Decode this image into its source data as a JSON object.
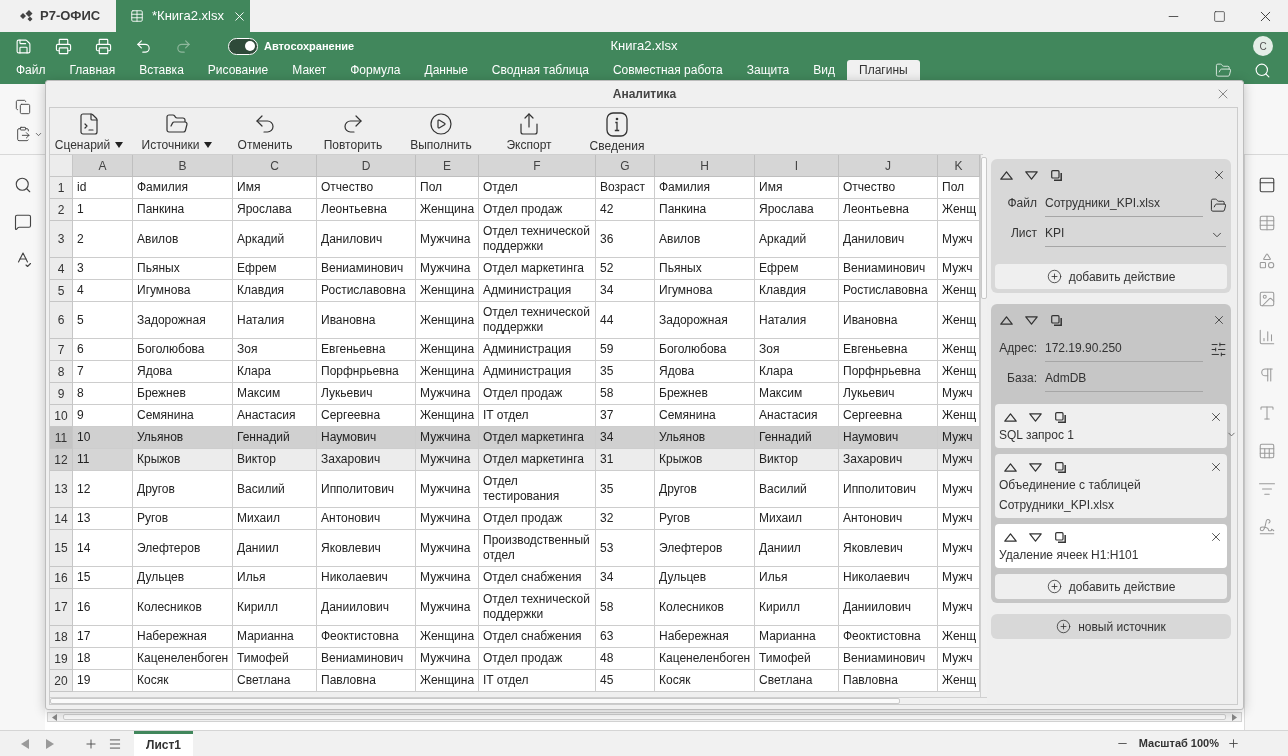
{
  "titlebar": {
    "logo": "Р7-ОФИС",
    "tabs": [
      {
        "label": "*Книга2.xlsx",
        "selected": true
      }
    ]
  },
  "header": {
    "tools": [
      {
        "kind": "save",
        "disabled": false
      },
      {
        "kind": "print",
        "disabled": false
      },
      {
        "kind": "quick_print",
        "disabled": false
      },
      {
        "kind": "undo",
        "disabled": false
      },
      {
        "kind": "redo",
        "disabled": true
      }
    ],
    "autosave": {
      "label": "Автосохранение",
      "on": true
    },
    "document_title": "Книга2.xlsx",
    "avatar": "С"
  },
  "menu": [
    {
      "label": "Файл",
      "selected": false
    },
    {
      "label": "Главная",
      "selected": false
    },
    {
      "label": "Вставка",
      "selected": false
    },
    {
      "label": "Рисование",
      "selected": false
    },
    {
      "label": "Макет",
      "selected": false
    },
    {
      "label": "Формула",
      "selected": false
    },
    {
      "label": "Данные",
      "selected": false
    },
    {
      "label": "Сводная таблица",
      "selected": false
    },
    {
      "label": "Совместная работа",
      "selected": false
    },
    {
      "label": "Защита",
      "selected": false
    },
    {
      "label": "Вид",
      "selected": false
    },
    {
      "label": "Плагины",
      "selected": true
    }
  ],
  "dialog": {
    "title": "Аналитика",
    "toolbar": [
      {
        "kind": "scenario",
        "label": "Сценарий",
        "has_menu": true
      },
      {
        "kind": "sources",
        "label": "Источники",
        "has_menu": true
      },
      {
        "kind": "undo",
        "label": "Отменить",
        "has_menu": false
      },
      {
        "kind": "redo",
        "label": "Повторить",
        "has_menu": false
      },
      {
        "kind": "run",
        "label": "Выполнить",
        "has_menu": false
      },
      {
        "kind": "export",
        "label": "Экспорт",
        "has_menu": false
      },
      {
        "kind": "info",
        "label": "Сведения",
        "has_menu": false
      }
    ],
    "grid": {
      "columns": [
        "A",
        "B",
        "C",
        "D",
        "E",
        "F",
        "G",
        "H",
        "I",
        "J",
        "K"
      ],
      "rows": [
        {
          "number": "1",
          "selected": false,
          "hovered": false,
          "cells": [
            "id",
            "Фамилия",
            "Имя",
            "Отчество",
            "Пол",
            "Отдел",
            "Возраст",
            "Фамилия",
            "Имя",
            "Отчество",
            "Пол"
          ]
        },
        {
          "number": "2",
          "selected": false,
          "hovered": false,
          "cells": [
            "1",
            "Панкина",
            "Ярослава",
            "Леонтьевна",
            "Женщина",
            "Отдел продаж",
            "42",
            "Панкина",
            "Ярослава",
            "Леонтьевна",
            "Женщ"
          ]
        },
        {
          "number": "3",
          "selected": false,
          "hovered": false,
          "cells": [
            "2",
            "Авилов",
            "Аркадий",
            "Данилович",
            "Мужчина",
            "Отдел технической поддержки",
            "36",
            "Авилов",
            "Аркадий",
            "Данилович",
            "Мужч"
          ]
        },
        {
          "number": "4",
          "selected": false,
          "hovered": false,
          "cells": [
            "3",
            "Пьяных",
            "Ефрем",
            "Вениаминович",
            "Мужчина",
            "Отдел маркетинга",
            "52",
            "Пьяных",
            "Ефрем",
            "Вениаминович",
            "Мужч"
          ]
        },
        {
          "number": "5",
          "selected": false,
          "hovered": false,
          "cells": [
            "4",
            "Игумнова",
            "Клавдия",
            "Ростиславовна",
            "Женщина",
            "Администрация",
            "34",
            "Игумнова",
            "Клавдия",
            "Ростиславовна",
            "Женщ"
          ]
        },
        {
          "number": "6",
          "selected": false,
          "hovered": false,
          "cells": [
            "5",
            "Задорожная",
            "Наталия",
            "Ивановна",
            "Женщина",
            "Отдел технической поддержки",
            "44",
            "Задорожная",
            "Наталия",
            "Ивановна",
            "Женщ"
          ]
        },
        {
          "number": "7",
          "selected": false,
          "hovered": false,
          "cells": [
            "6",
            "Боголюбова",
            "Зоя",
            "Евгеньевна",
            "Женщина",
            "Администрация",
            "59",
            "Боголюбова",
            "Зоя",
            "Евгеньевна",
            "Женщ"
          ]
        },
        {
          "number": "8",
          "selected": false,
          "hovered": false,
          "cells": [
            "7",
            "Ядова",
            "Клара",
            "Порфнрьевна",
            "Женщина",
            "Администрация",
            "35",
            "Ядова",
            "Клара",
            "Порфнрьевна",
            "Женщ"
          ]
        },
        {
          "number": "9",
          "selected": false,
          "hovered": false,
          "cells": [
            "8",
            "Брежнев",
            "Максим",
            "Лукьевич",
            "Мужчина",
            "Отдел продаж",
            "58",
            "Брежнев",
            "Максим",
            "Лукьевич",
            "Мужч"
          ]
        },
        {
          "number": "10",
          "selected": false,
          "hovered": false,
          "cells": [
            "9",
            "Семянина",
            "Анастасия",
            "Сергеевна",
            "Женщина",
            "IT отдел",
            "37",
            "Семянина",
            "Анастасия",
            "Сергеевна",
            "Женщ"
          ]
        },
        {
          "number": "11",
          "selected": true,
          "hovered": false,
          "cells": [
            "10",
            "Ульянов",
            "Геннадий",
            "Наумович",
            "Мужчина",
            "Отдел маркетинга",
            "34",
            "Ульянов",
            "Геннадий",
            "Наумович",
            "Мужч"
          ]
        },
        {
          "number": "12",
          "selected": false,
          "hovered": true,
          "cells": [
            "11",
            "Крыжов",
            "Виктор",
            "Захарович",
            "Мужчина",
            "Отдел маркетинга",
            "31",
            "Крыжов",
            "Виктор",
            "Захарович",
            "Мужч"
          ]
        },
        {
          "number": "13",
          "selected": false,
          "hovered": false,
          "cells": [
            "12",
            "Другов",
            "Василий",
            "Ипполитович",
            "Мужчина",
            "Отдел тестирования",
            "35",
            "Другов",
            "Василий",
            "Ипполитович",
            "Мужч"
          ]
        },
        {
          "number": "14",
          "selected": false,
          "hovered": false,
          "cells": [
            "13",
            "Ругов",
            "Михаил",
            "Антонович",
            "Мужчина",
            "Отдел продаж",
            "32",
            "Ругов",
            "Михаил",
            "Антонович",
            "Мужч"
          ]
        },
        {
          "number": "15",
          "selected": false,
          "hovered": false,
          "cells": [
            "14",
            "Элефтеров",
            "Даниил",
            "Яковлевич",
            "Мужчина",
            "Производственный отдел",
            "53",
            "Элефтеров",
            "Даниил",
            "Яковлевич",
            "Мужч"
          ]
        },
        {
          "number": "16",
          "selected": false,
          "hovered": false,
          "cells": [
            "15",
            "Дульцев",
            "Илья",
            "Николаевич",
            "Мужчина",
            "Отдел снабжения",
            "34",
            "Дульцев",
            "Илья",
            "Николаевич",
            "Мужч"
          ]
        },
        {
          "number": "17",
          "selected": false,
          "hovered": false,
          "cells": [
            "16",
            "Колесников",
            "Кирилл",
            "Даниилович",
            "Мужчина",
            "Отдел технической поддержки",
            "58",
            "Колесников",
            "Кирилл",
            "Даниилович",
            "Мужч"
          ]
        },
        {
          "number": "18",
          "selected": false,
          "hovered": false,
          "cells": [
            "17",
            "Набережная",
            "Марианна",
            "Феоктистовна",
            "Женщина",
            "Отдел снабжения",
            "63",
            "Набережная",
            "Марианна",
            "Феоктистовна",
            "Женщ"
          ]
        },
        {
          "number": "19",
          "selected": false,
          "hovered": false,
          "cells": [
            "18",
            "Каценеленбоген",
            "Тимофей",
            "Вениаминович",
            "Мужчина",
            "Отдел продаж",
            "48",
            "Каценеленбоген",
            "Тимофей",
            "Вениаминович",
            "Мужч"
          ]
        },
        {
          "number": "20",
          "selected": false,
          "hovered": false,
          "cells": [
            "19",
            "Косяк",
            "Светлана",
            "Павловна",
            "Женщина",
            "IT отдел",
            "45",
            "Косяк",
            "Светлана",
            "Павловна",
            "Женщ"
          ]
        }
      ]
    },
    "sources": [
      {
        "selected": false,
        "fields": [
          {
            "kind": "file",
            "label": "Файл",
            "value": "Сотрудники_KPI.xlsx"
          },
          {
            "kind": "dropdown",
            "label": "Лист",
            "value": "KPI"
          }
        ],
        "add_action": "добавить действие"
      },
      {
        "selected": true,
        "fields": [
          {
            "kind": "address",
            "label": "Адрес:",
            "value": "172.19.90.250"
          },
          {
            "kind": "text",
            "label": "База:",
            "value": "AdmDB"
          }
        ],
        "actions": [
          {
            "label": "SQL запрос 1",
            "selected": false
          },
          {
            "label": "Объединение с таблицей Сотрудники_KPI.xlsx",
            "selected": false
          },
          {
            "label": "Удаление ячеек H1:H101",
            "selected": true
          }
        ],
        "add_action": "добавить действие"
      }
    ],
    "new_source": "новый источник"
  },
  "sheet_tabs": [
    {
      "label": "Лист1",
      "selected": true
    }
  ],
  "zoom": "Масштаб 100%"
}
